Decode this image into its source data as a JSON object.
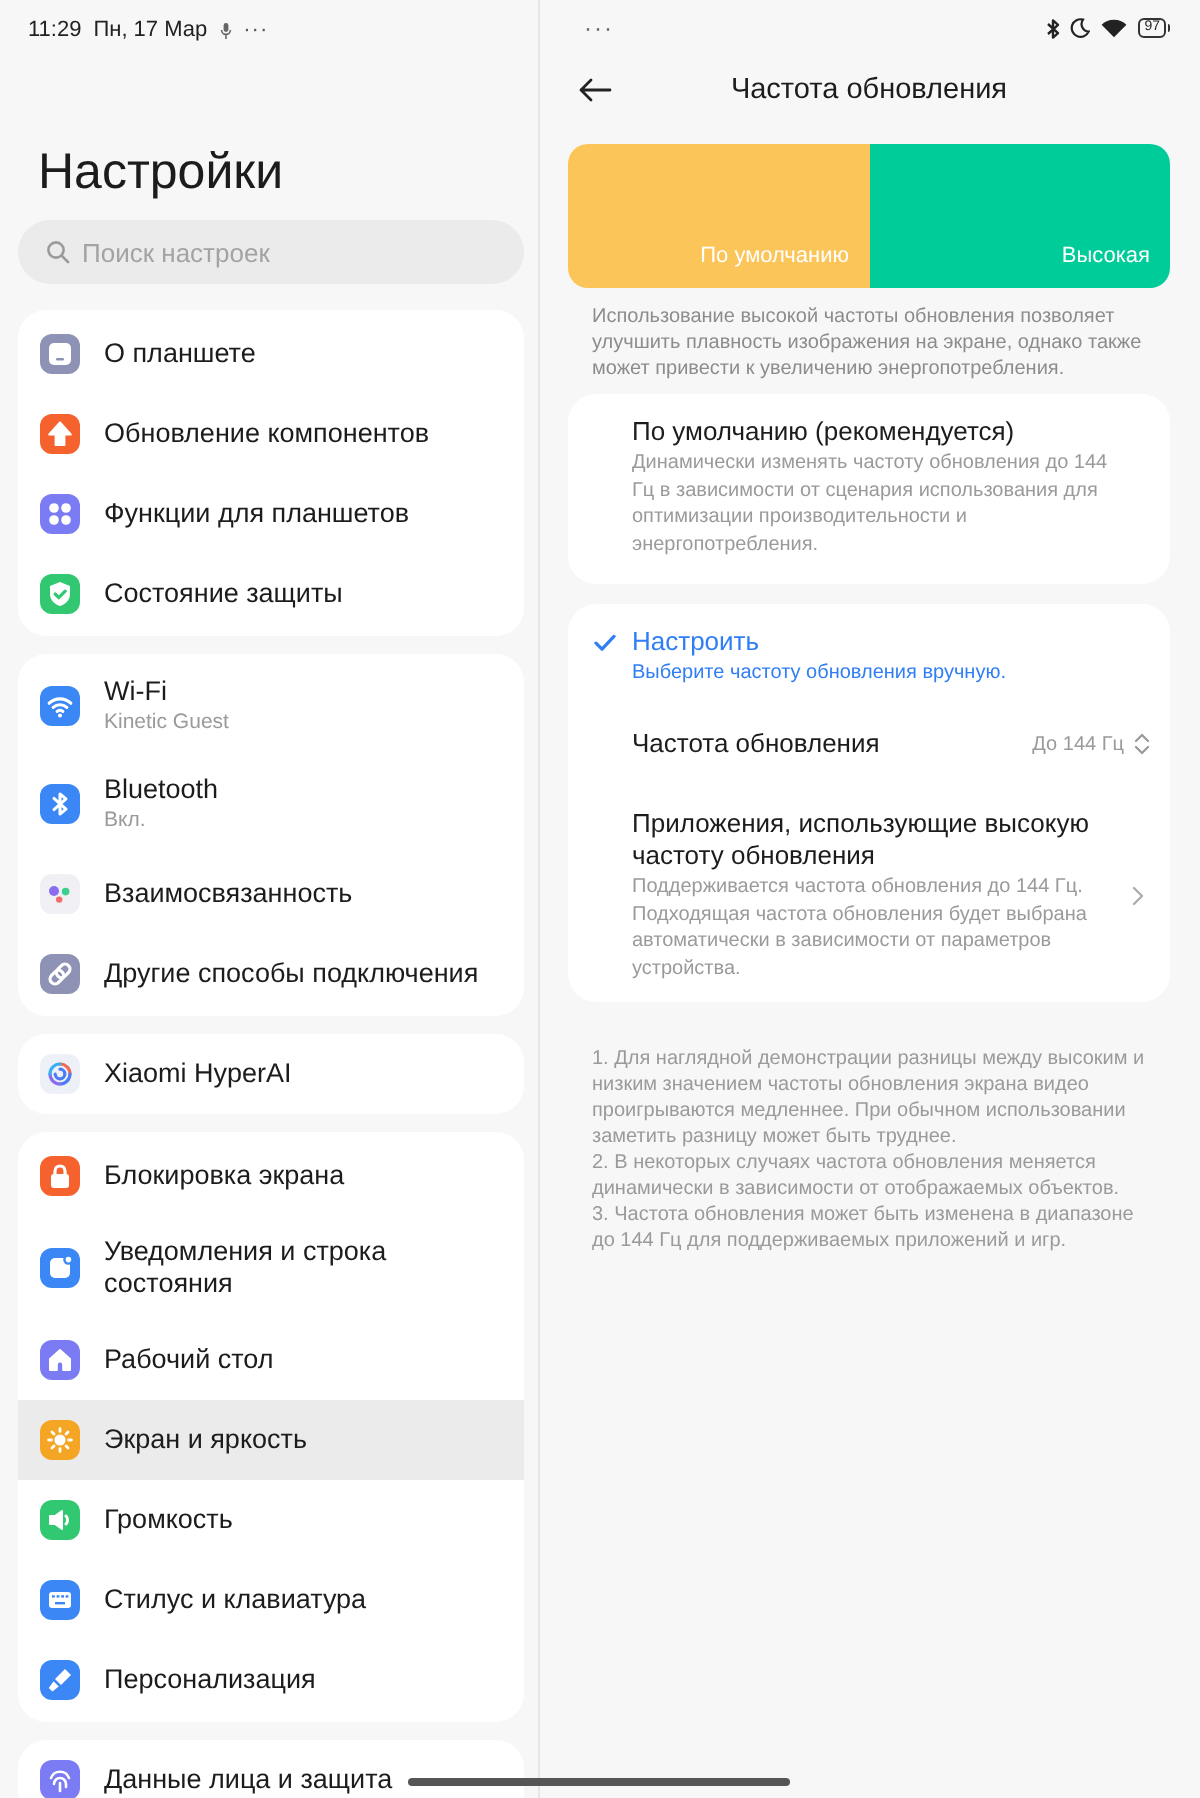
{
  "status_bar": {
    "time": "11:29",
    "date": "Пн, 17 Мар",
    "overflow": "···",
    "battery": "97"
  },
  "sidebar": {
    "title": "Настройки",
    "search": {
      "placeholder": "Поиск настроек"
    },
    "groups": [
      {
        "items": [
          {
            "label": "О планшете",
            "color": "#8e92b4",
            "selected": false
          },
          {
            "label": "Обновление компонентов",
            "color": "#f5622e",
            "selected": false
          },
          {
            "label": "Функции для планшетов",
            "color": "#7b7cf4",
            "selected": false
          },
          {
            "label": "Состояние защиты",
            "color": "#32c872",
            "selected": false
          }
        ]
      },
      {
        "items": [
          {
            "label": "Wi-Fi",
            "subtitle": "Kinetic Guest",
            "color": "#3c87f6",
            "selected": false
          },
          {
            "label": "Bluetooth",
            "subtitle": "Вкл.",
            "color": "#3c87f6",
            "selected": false
          },
          {
            "label": "Взаимосвязанность",
            "color": "#efeff4",
            "selected": false
          },
          {
            "label": "Другие способы подключения",
            "color": "#8e92b4",
            "selected": false
          }
        ]
      },
      {
        "items": [
          {
            "label": "Xiaomi HyperAI",
            "color": "#eef0f8",
            "selected": false
          }
        ]
      },
      {
        "items": [
          {
            "label": "Блокировка экрана",
            "color": "#f5622e",
            "selected": false
          },
          {
            "label": "Уведомления и строка состояния",
            "color": "#3c87f6",
            "selected": false
          },
          {
            "label": "Рабочий стол",
            "color": "#7b7cf4",
            "selected": false
          },
          {
            "label": "Экран и яркость",
            "color": "#f5a524",
            "selected": true
          },
          {
            "label": "Громкость",
            "color": "#32c872",
            "selected": false
          },
          {
            "label": "Стилус и клавиатура",
            "color": "#3c87f6",
            "selected": false
          },
          {
            "label": "Персонализация",
            "color": "#3c87f6",
            "selected": false
          }
        ]
      },
      {
        "items": [
          {
            "label": "Данные лица и защита",
            "color": "#7b7cf4",
            "selected": false
          }
        ]
      }
    ]
  },
  "detail": {
    "window_handle": "···",
    "title": "Частота обновления",
    "preview": {
      "segments": [
        {
          "label": "По умолчанию",
          "color": "#fcc55a"
        },
        {
          "label": "Высокая",
          "color": "#00cc99"
        }
      ]
    },
    "description": "Использование высокой частоты обновления позволяет улучшить плавность изображения на экране, однако также может привести к увеличению энергопотребления.",
    "options": [
      {
        "title": "По умолчанию (рекомендуется)",
        "description": "Динамически изменять частоту обновления до 144 Гц в зависимости от сценария использования для оптимизации производительности и энергопотребления.",
        "selected": false
      },
      {
        "title": "Настроить",
        "description": "Выберите частоту обновления вручную.",
        "selected": true,
        "settings": [
          {
            "kind": "select",
            "label": "Частота обновления",
            "value": "До 144 Гц"
          },
          {
            "kind": "link",
            "label": "Приложения, использующие высокую частоту обновления",
            "description": "Поддерживается частота обновления до 144 Гц. Подходящая частота обновления будет выбрана автоматически в зависимости от параметров устройства."
          }
        ]
      }
    ],
    "footnotes": [
      "1. Для наглядной демонстрации разницы между высоким и низким значением частоты обновления экрана видео проигрываются медленнее. При обычном использовании заметить разницу может быть труднее.",
      "2. В некоторых случаях частота обновления меняется динамически в зависимости от отображаемых объектов.",
      "3. Частота обновления может быть изменена в диапазоне до 144 Гц для поддерживаемых приложений и игр."
    ]
  }
}
